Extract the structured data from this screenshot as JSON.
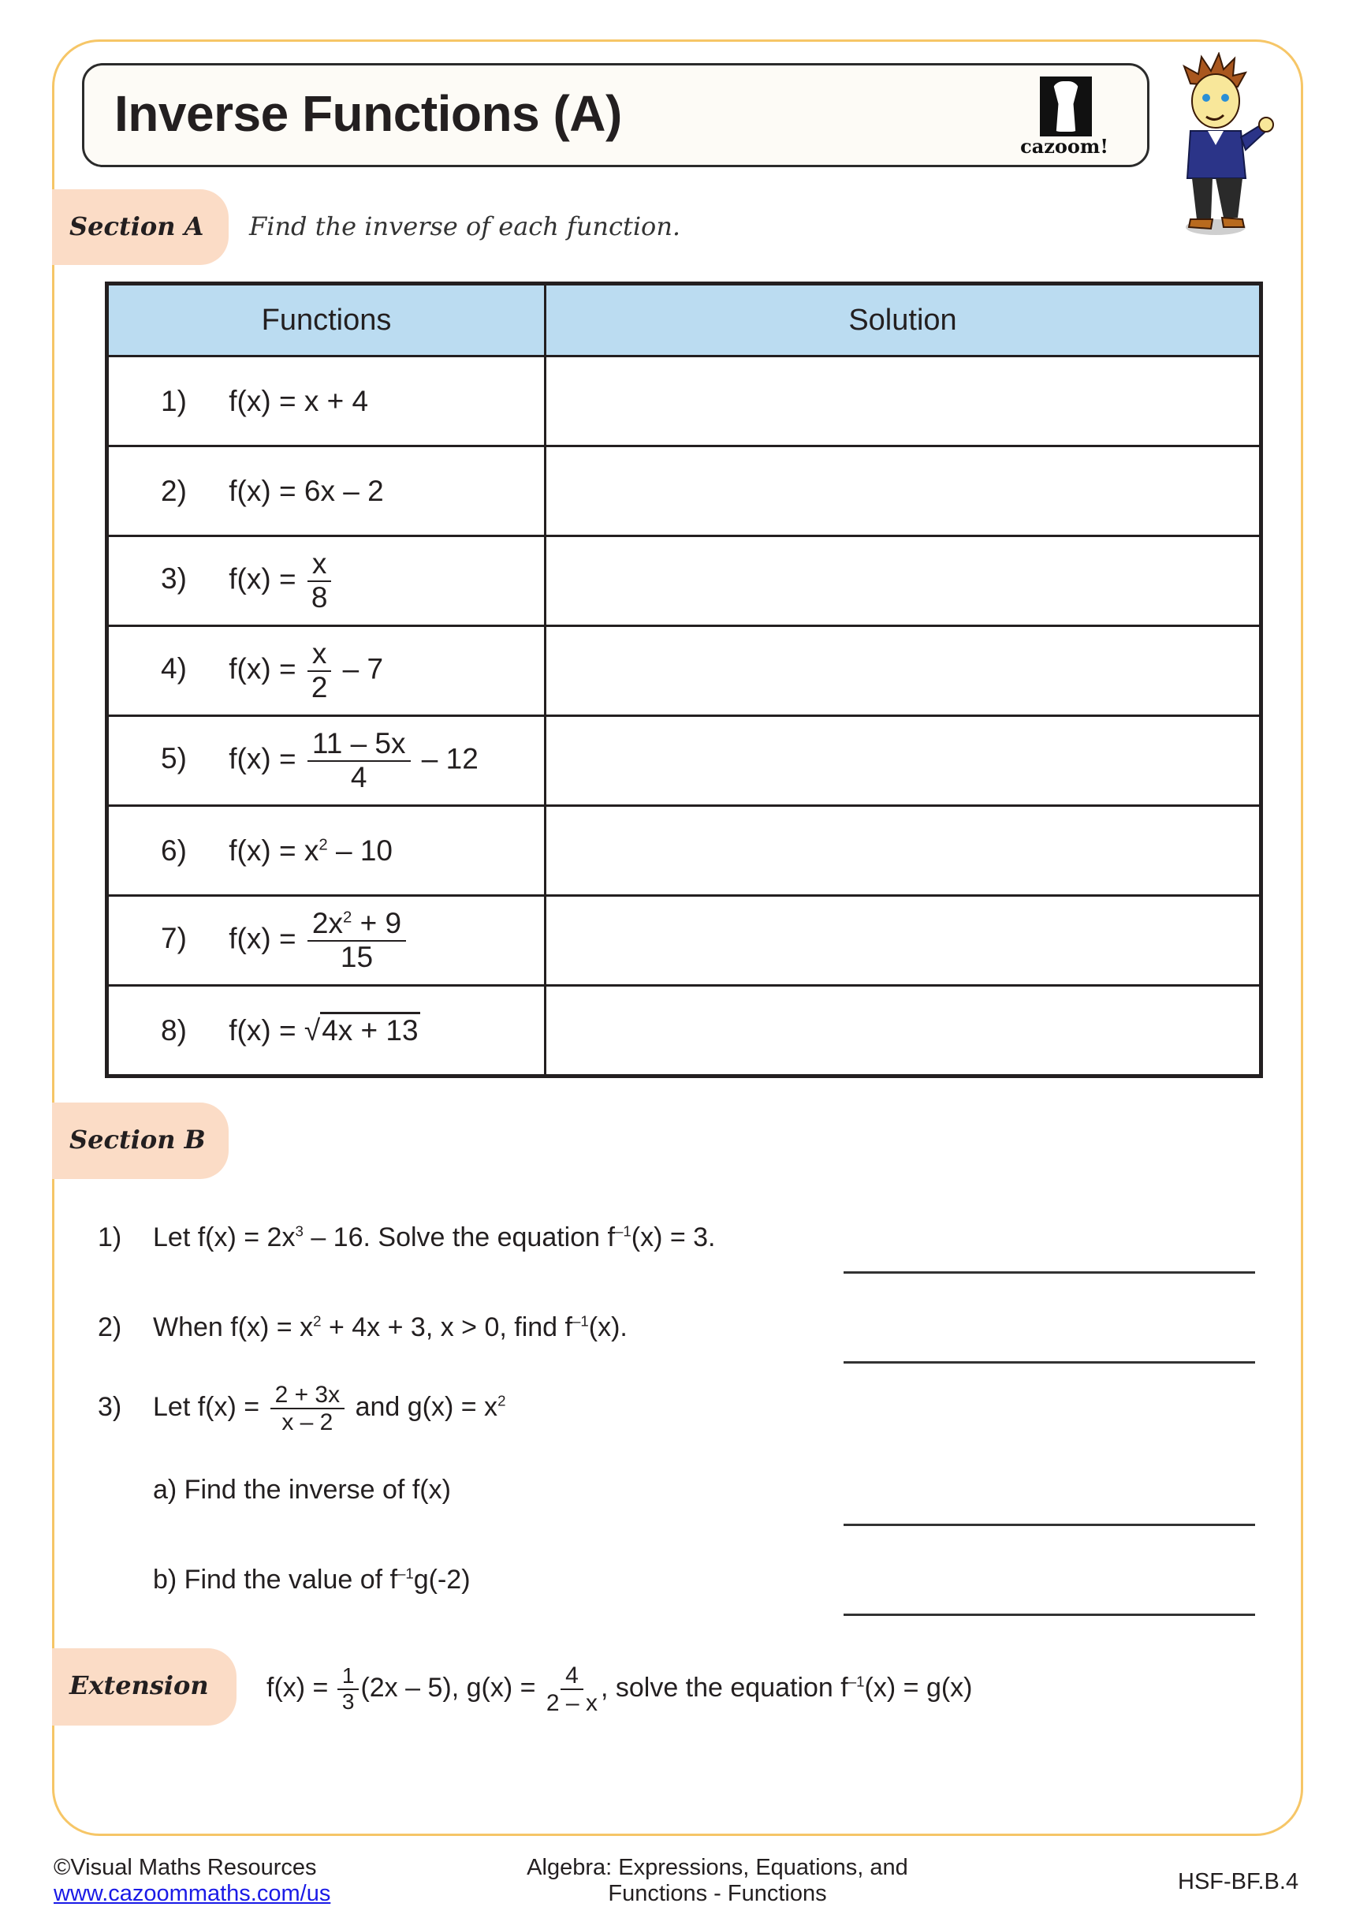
{
  "header": {
    "title": "Inverse Functions (A)",
    "logo_text": "cazoom!",
    "logo_icon": "drum-logo-icon",
    "mascot_icon": "cartoon-boy-thumbs-up"
  },
  "section_a": {
    "tab_label": "Section A",
    "instruction": "Find the inverse of each function.",
    "table": {
      "headers": [
        "Functions",
        "Solution"
      ],
      "header_color": "#bbdcf1",
      "rows": [
        {
          "num": "1)",
          "lhs": "f(x) =",
          "expr": "x + 4"
        },
        {
          "num": "2)",
          "lhs": "f(x) =",
          "expr": "6x – 2"
        },
        {
          "num": "3)",
          "lhs": "f(x) =",
          "frac_num": "x",
          "frac_den": "8",
          "after": ""
        },
        {
          "num": "4)",
          "lhs": "f(x) =",
          "frac_num": "x",
          "frac_den": "2",
          "after": "– 7"
        },
        {
          "num": "5)",
          "lhs": "f(x) =",
          "frac_num": "11 – 5x",
          "frac_den": "4",
          "after": "– 12"
        },
        {
          "num": "6)",
          "lhs": "f(x) =",
          "base": "x",
          "exp": "2",
          "rest": "– 10"
        },
        {
          "num": "7)",
          "lhs": "f(x) =",
          "frac_num_base": "2x",
          "frac_num_exp": "2",
          "frac_num_rest": "+ 9",
          "frac_den": "15"
        },
        {
          "num": "8)",
          "lhs": "f(x) =",
          "sqrt_sign": "√",
          "radicand": "4x + 13"
        }
      ]
    }
  },
  "section_b": {
    "tab_label": "Section B",
    "q1": {
      "num": "1)",
      "pre": "Let f(x) = 2x",
      "exp": "3",
      "mid": " – 16. Solve the equation f",
      "inv": "–1",
      "post": "(x) = 3."
    },
    "q2": {
      "num": "2)",
      "pre": "When f(x) = x",
      "exp": "2",
      "mid": " + 4x + 3, x > 0, find f",
      "inv": "–1",
      "post": "(x)."
    },
    "q3": {
      "num": "3)",
      "pre": "Let f(x) =",
      "frac_num": "2 + 3x",
      "frac_den": "x – 2",
      "mid": "and  g(x) = x",
      "exp": "2"
    },
    "q3a": "a) Find the inverse of f(x)",
    "q3b": {
      "pre": "b) Find the value of f",
      "inv": "–1",
      "post": "g(-2)"
    }
  },
  "extension": {
    "tab_label": "Extension",
    "f_lhs": "f(x) =",
    "f_frac_num": "1",
    "f_frac_den": "3",
    "f_rest": "(2x – 5), g(x) =",
    "g_frac_num": "4",
    "g_frac_den": "2 – x",
    "comma": ",",
    "task_pre": "solve the equation f",
    "task_inv": "–1",
    "task_post": "(x) = g(x)"
  },
  "footer": {
    "copyright": "©Visual Maths Resources",
    "link": "www.cazoommaths.com/us",
    "topic_line1": "Algebra: Expressions, Equations, and",
    "topic_line2": "Functions - Functions",
    "standard": "HSF-BF.B.4"
  },
  "colors": {
    "frame_border": "#f6c667",
    "tab_fill": "#fbdcc6",
    "header_fill": "#bbdcf1",
    "link": "#1a1ae6"
  }
}
